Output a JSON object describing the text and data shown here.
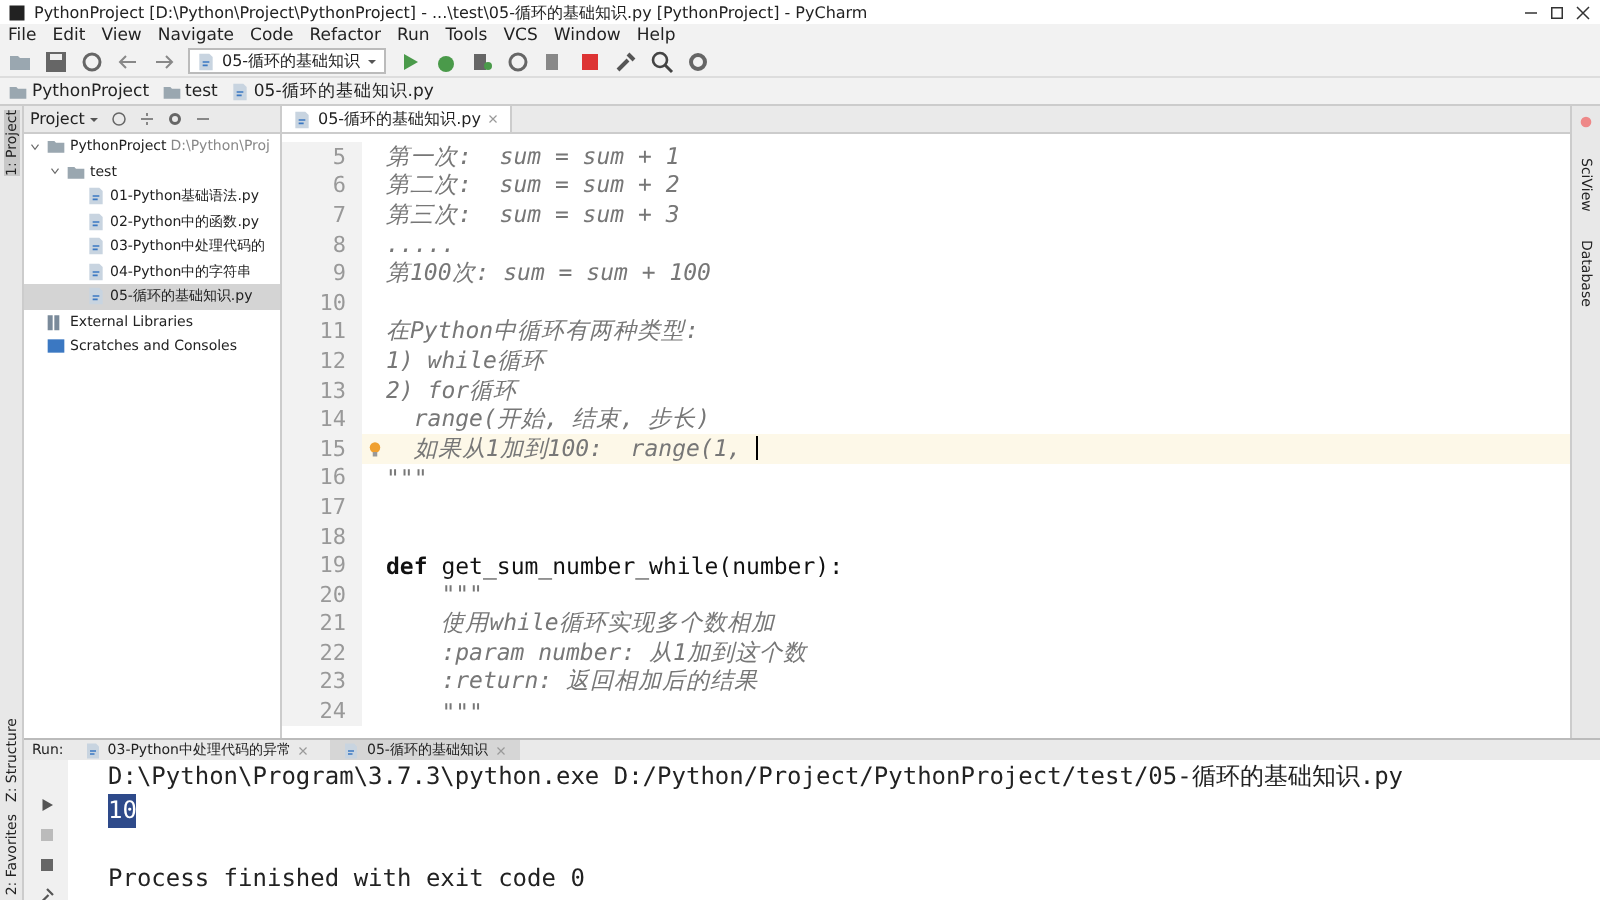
{
  "window": {
    "title": "PythonProject [D:\\Python\\Project\\PythonProject] - ...\\test\\05-循环的基础知识.py [PythonProject] - PyCharm"
  },
  "menu": [
    "File",
    "Edit",
    "View",
    "Navigate",
    "Code",
    "Refactor",
    "Run",
    "Tools",
    "VCS",
    "Window",
    "Help"
  ],
  "toolbar": {
    "run_config": "05-循环的基础知识"
  },
  "breadcrumbs": [
    "PythonProject",
    "test",
    "05-循环的基础知识.py"
  ],
  "left_stripe": [
    {
      "label": "1: Project",
      "selected": true
    }
  ],
  "left_stripe_bottom": [
    {
      "label": "Z: Structure",
      "selected": false
    },
    {
      "label": "2: Favorites",
      "selected": false
    }
  ],
  "right_stripe": [
    "SciView",
    "Database"
  ],
  "project": {
    "title": "Project",
    "tree": [
      {
        "label": "PythonProject",
        "note": "D:\\Python\\Proj",
        "kind": "folder",
        "expanded": true,
        "selected": false,
        "children": [
          {
            "label": "test",
            "kind": "folder",
            "expanded": true,
            "selected": false,
            "children": [
              {
                "label": "01-Python基础语法.py",
                "kind": "file",
                "selected": false
              },
              {
                "label": "02-Python中的函数.py",
                "kind": "file",
                "selected": false
              },
              {
                "label": "03-Python中处理代码的",
                "kind": "file",
                "selected": false
              },
              {
                "label": "04-Python中的字符串",
                "kind": "file",
                "selected": false
              },
              {
                "label": "05-循环的基础知识.py",
                "kind": "file",
                "selected": true
              }
            ]
          }
        ]
      },
      {
        "label": "External Libraries",
        "kind": "library",
        "selected": false
      },
      {
        "label": "Scratches and Consoles",
        "kind": "scratch",
        "selected": false
      }
    ]
  },
  "editor": {
    "tab": "05-循环的基础知识.py",
    "lines": [
      {
        "number": "5",
        "text": "第一次:  sum = sum + 1",
        "kind": "doc",
        "current": false
      },
      {
        "number": "6",
        "text": "第二次:  sum = sum + 2",
        "kind": "doc",
        "current": false
      },
      {
        "number": "7",
        "text": "第三次:  sum = sum + 3",
        "kind": "doc",
        "current": false
      },
      {
        "number": "8",
        "text": ".....",
        "kind": "doc",
        "current": false
      },
      {
        "number": "9",
        "text": "第100次: sum = sum + 100",
        "kind": "doc",
        "current": false
      },
      {
        "number": "10",
        "current": false
      },
      {
        "number": "11",
        "text": "在Python中循环有两种类型:",
        "kind": "doc",
        "current": false
      },
      {
        "number": "12",
        "text": "1) while循环",
        "kind": "doc",
        "current": false
      },
      {
        "number": "13",
        "text": "2) for循环",
        "kind": "doc",
        "current": false
      },
      {
        "number": "14",
        "text": "  range(开始, 结束, 步长)",
        "kind": "doc",
        "current": false
      },
      {
        "number": "15",
        "text": "  如果从1加到100:  range(1, ",
        "kind": "doc",
        "current": true
      },
      {
        "number": "16",
        "text": "\"\"\"",
        "kind": "doc",
        "current": false
      },
      {
        "number": "17",
        "current": false
      },
      {
        "number": "18",
        "current": false
      },
      {
        "number": "19",
        "text": "**def** get_sum_number_while(number):",
        "kind": "code",
        "current": false
      },
      {
        "number": "20",
        "text": "    \"\"\"",
        "kind": "doc",
        "current": false
      },
      {
        "number": "21",
        "text": "    使用while循环实现多个数相加",
        "kind": "doc",
        "current": false
      },
      {
        "number": "22",
        "text": "    :param number: 从1加到这个数",
        "kind": "doc",
        "current": false
      },
      {
        "number": "23",
        "text": "    :return: 返回相加后的结果",
        "kind": "doc",
        "current": false
      },
      {
        "number": "24",
        "text": "    \"\"\"",
        "kind": "doc",
        "current": false
      }
    ]
  },
  "run": {
    "label": "Run:",
    "tabs": [
      {
        "label": "03-Python中处理代码的异常",
        "selected": false
      },
      {
        "label": "05-循环的基础知识",
        "selected": true
      }
    ],
    "output": [
      {
        "text": "D:\\Python\\Program\\3.7.3\\python.exe D:/Python/Project/PythonProject/test/05-循环的基础知识.py",
        "selected": false
      },
      {
        "text": "10",
        "selected": true
      },
      {
        "text": "Process finished with exit code 0",
        "selected": false,
        "gap_before": true
      }
    ]
  }
}
